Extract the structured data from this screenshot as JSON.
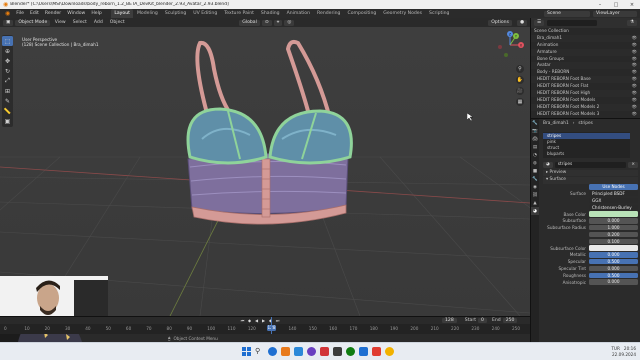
{
  "window": {
    "title": "Blender* [C:\\Users\\MSI\\Downloads\\body_reborn_1.2_BETA_DevKit_blender_2.93_Avatar_2.93.blend]",
    "controls": [
      "–",
      "□",
      "×"
    ]
  },
  "menubar": {
    "menus": [
      "File",
      "Edit",
      "Render",
      "Window",
      "Help"
    ],
    "workspaces": [
      "Layout",
      "Modeling",
      "Sculpting",
      "UV Editing",
      "Texture Paint",
      "Shading",
      "Animation",
      "Rendering",
      "Compositing",
      "Geometry Nodes",
      "Scripting"
    ],
    "active_workspace": "Layout",
    "scene_label": "Scene",
    "view_layer_label": "ViewLayer"
  },
  "viewport": {
    "mode": "Object Mode",
    "menus": [
      "View",
      "Select",
      "Add",
      "Object"
    ],
    "orientation": "Global",
    "options_label": "Options",
    "info_line1": "User Perspective",
    "info_line2": "(128) Scene Collection | Bra_dimah1",
    "axis_labels": [
      "X",
      "Y",
      "Z"
    ]
  },
  "timeline": {
    "current_frame": "128",
    "start_label": "Start",
    "start": "0",
    "end_label": "End",
    "end": "250",
    "ticks": [
      "0",
      "10",
      "20",
      "30",
      "40",
      "50",
      "60",
      "70",
      "80",
      "90",
      "100",
      "110",
      "120",
      "130",
      "140",
      "150",
      "160",
      "170",
      "180",
      "190",
      "200",
      "210",
      "220",
      "230",
      "240",
      "250"
    ]
  },
  "statusbar": {
    "text": "Object Context Menu"
  },
  "taskbar": {
    "time": "20:16",
    "date": "22.09.2024",
    "lang": "TUR",
    "icon_colors": [
      "#1f6fd1",
      "#e87a1d",
      "#2b88d8",
      "#6a3fc0",
      "#d13438",
      "#3c3c3c",
      "#107c10",
      "#1f6fd1",
      "#e03c31",
      "#f2b200"
    ]
  },
  "outliner": {
    "search_placeholder": "",
    "header": "Scene Collection",
    "rows": [
      "Bra_dimah1",
      "Animation",
      "Armature",
      "Bone Groups",
      "Avatar",
      "Body - REBORN",
      "HEDIT REBORN Foot Base",
      "HEDIT REBORN Foot Flat",
      "HEDIT REBORN Foot High",
      "HEDIT REBORN Foot Models",
      "HEDIT REBORN Foot Models 2",
      "HEDIT REBORN Foot Models 3",
      "Bra_dimah1",
      "Hoodie"
    ],
    "selected_row": 12
  },
  "properties": {
    "object_name": "Bra_dimah1",
    "material_name": "stripes",
    "slots": [
      "stripes",
      "pink",
      "struct",
      "bluparts"
    ],
    "selected_slot": 0,
    "material_field": "stripes",
    "sections": [
      "Preview",
      "Surface"
    ],
    "use_nodes": "Use Nodes",
    "surface_label": "Surface",
    "surface_value": "Principled BSDF",
    "distribution": "GGX",
    "subsurface_method": "Christensen-Burley",
    "rows": [
      {
        "label": "Base Color",
        "value": "",
        "color": "#b9e3b8"
      },
      {
        "label": "Subsurface",
        "value": "0.000"
      },
      {
        "label": "Subsurface Radius",
        "value": "1.000"
      },
      {
        "label": "",
        "value": "0.200"
      },
      {
        "label": "",
        "value": "0.100"
      },
      {
        "label": "Subsurface Color",
        "value": "",
        "color": "#e8e8e8"
      },
      {
        "label": "Metallic",
        "value": "0.000",
        "blue": true
      },
      {
        "label": "Specular",
        "value": "0.500",
        "blue": true
      },
      {
        "label": "Specular Tint",
        "value": "0.000"
      },
      {
        "label": "Roughness",
        "value": "0.500",
        "blue": true
      },
      {
        "label": "Anisotropic",
        "value": "0.000"
      }
    ]
  },
  "colors": {
    "accent": "#4772b3",
    "viewport_bg": "#3d3d3d",
    "strap_pink": "#d49a96",
    "cup_blue": "#5f8fa8",
    "trim_green": "#8fd39a",
    "band_purple": "#8a7aa8"
  }
}
